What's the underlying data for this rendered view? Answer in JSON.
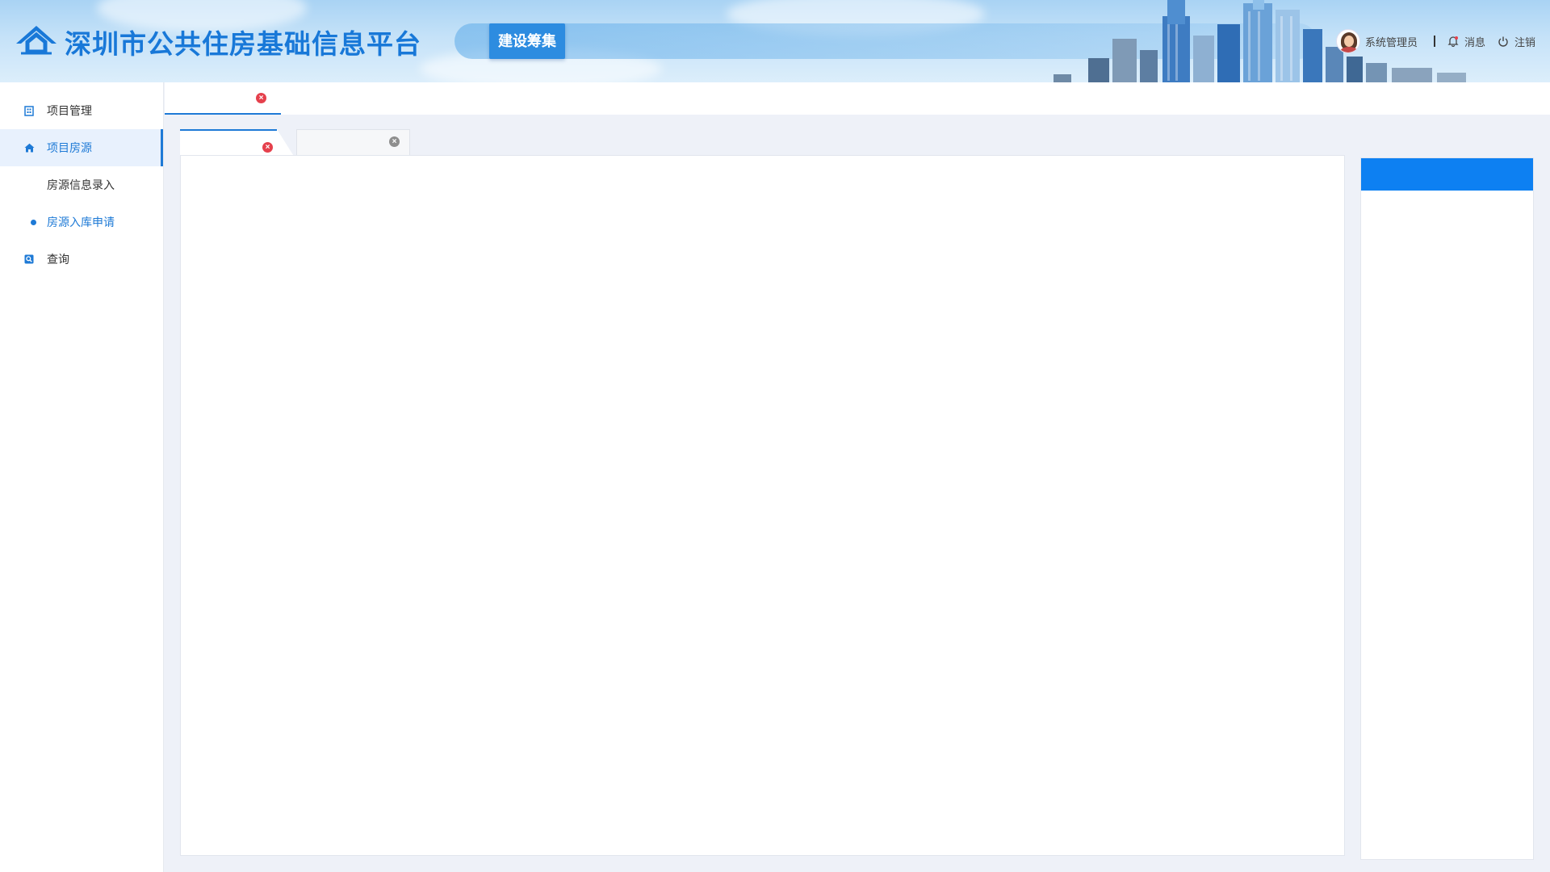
{
  "header": {
    "app_title": "深圳市公共住房基础信息平台",
    "nav_button": "建设筹集",
    "user_name": "系统管理员",
    "messages_label": "消息",
    "logout_label": "注销"
  },
  "sidebar": {
    "items": [
      {
        "label": "项目管理",
        "icon": "building-icon"
      },
      {
        "label": "项目房源",
        "icon": "home-icon",
        "active": true
      },
      {
        "label": "房源信息录入",
        "sub": true
      },
      {
        "label": "房源入库申请",
        "sub": true,
        "current": true
      },
      {
        "label": "查询",
        "icon": "search-icon"
      }
    ]
  },
  "tabs": {
    "top": [
      {
        "label": ""
      }
    ],
    "inner": [
      {
        "label": "",
        "active": true
      },
      {
        "label": ""
      }
    ]
  },
  "colors": {
    "brand_blue": "#1878d8",
    "accent_blue": "#0d80f2",
    "close_red": "#e5404c"
  }
}
